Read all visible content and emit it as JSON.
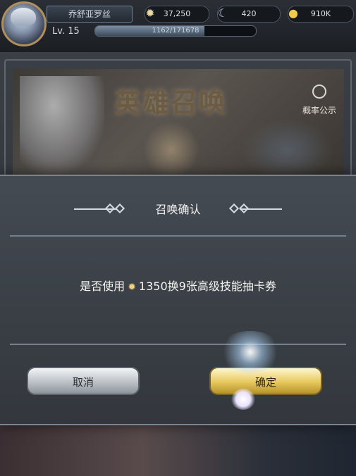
{
  "player": {
    "name": "乔舒亚罗丝",
    "level": "Lv. 15",
    "exp_text": "1162/171678",
    "exp_fraction": 0.68
  },
  "resources": [
    {
      "name": "sun-currency",
      "icon": "sun-icon",
      "value": "37,250"
    },
    {
      "name": "moon-currency",
      "icon": "moon-icon",
      "value": "420"
    },
    {
      "name": "gold",
      "icon": "coin-icon",
      "value": "910K"
    }
  ],
  "banner": {
    "title": "英雄召唤",
    "probability_link": "概率公示"
  },
  "dialog": {
    "title": "召唤确认",
    "message_prefix": "是否使用",
    "message_rest": "1350换9张高级技能抽卡券",
    "cancel_label": "取消",
    "confirm_label": "确定"
  },
  "colors": {
    "confirm_button": "#e7c85c",
    "cancel_button": "#b6bcc2",
    "dialog_bg": "#3f444b"
  }
}
